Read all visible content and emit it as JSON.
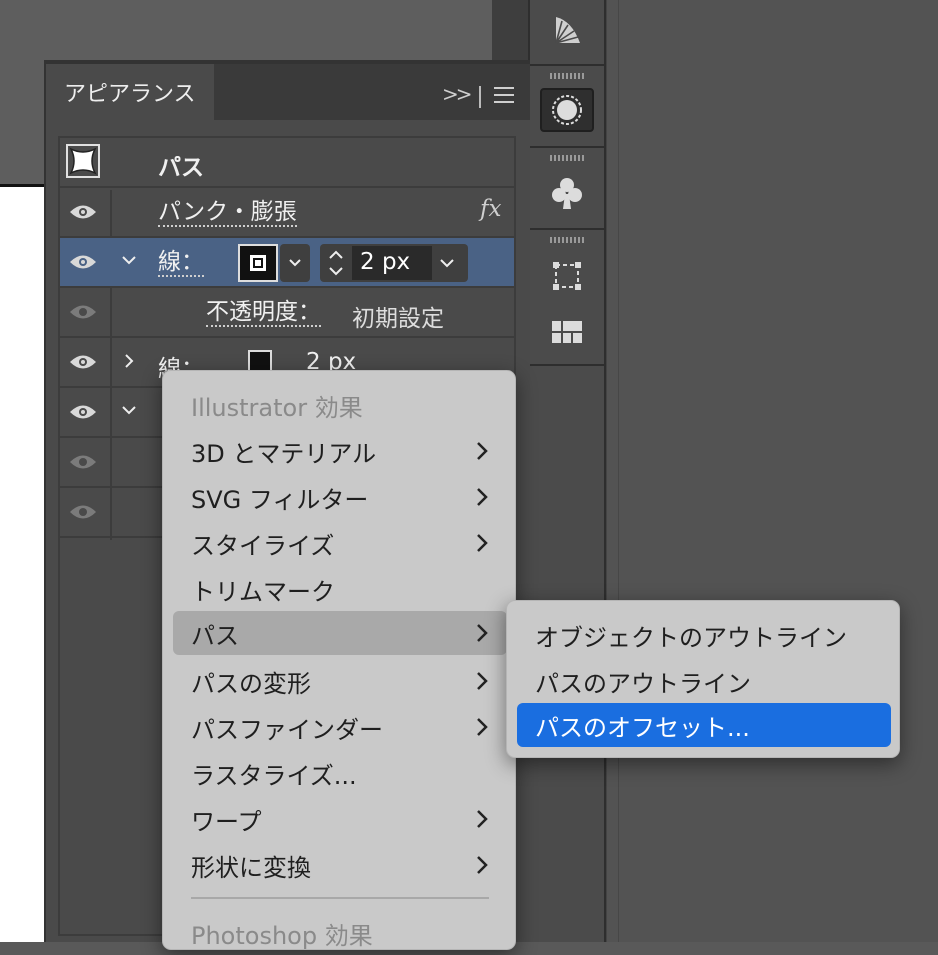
{
  "panel": {
    "tab_title": "アピアランス",
    "collapse_glyph": ">>",
    "rows": {
      "path_title": "パス",
      "effect_name": "パンク・膨張",
      "fx_label": "fx",
      "stroke_label": "線：",
      "stroke_weight_value": "2 px",
      "opacity_label": "不透明度：",
      "opacity_value": "初期設定",
      "stroke2_label": "線：",
      "stroke2_weight": "2 px"
    }
  },
  "effects_menu": {
    "header1": "Illustrator 効果",
    "items": [
      "3D とマテリアル",
      "SVG フィルター",
      "スタイライズ",
      "トリムマーク",
      "パス",
      "パスの変形",
      "パスファインダー",
      "ラスタライズ...",
      "ワープ",
      "形状に変換"
    ],
    "header2": "Photoshop 効果"
  },
  "path_submenu": {
    "items": [
      "オブジェクトのアウトライン",
      "パスのアウトライン",
      "パスのオフセット..."
    ]
  },
  "colors": {
    "selected_row": "#4a6285",
    "menu_highlight_blue": "#1a6ee0",
    "menu_background": "#c9c9c9"
  },
  "icons": [
    "brush-spread-icon",
    "dashed-circle-icon",
    "club-icon",
    "artboard-icon",
    "grid-icon",
    "eye-icon",
    "chevron-down-icon",
    "chevron-right-icon",
    "hamburger-menu-icon",
    "stepper-icon"
  ]
}
